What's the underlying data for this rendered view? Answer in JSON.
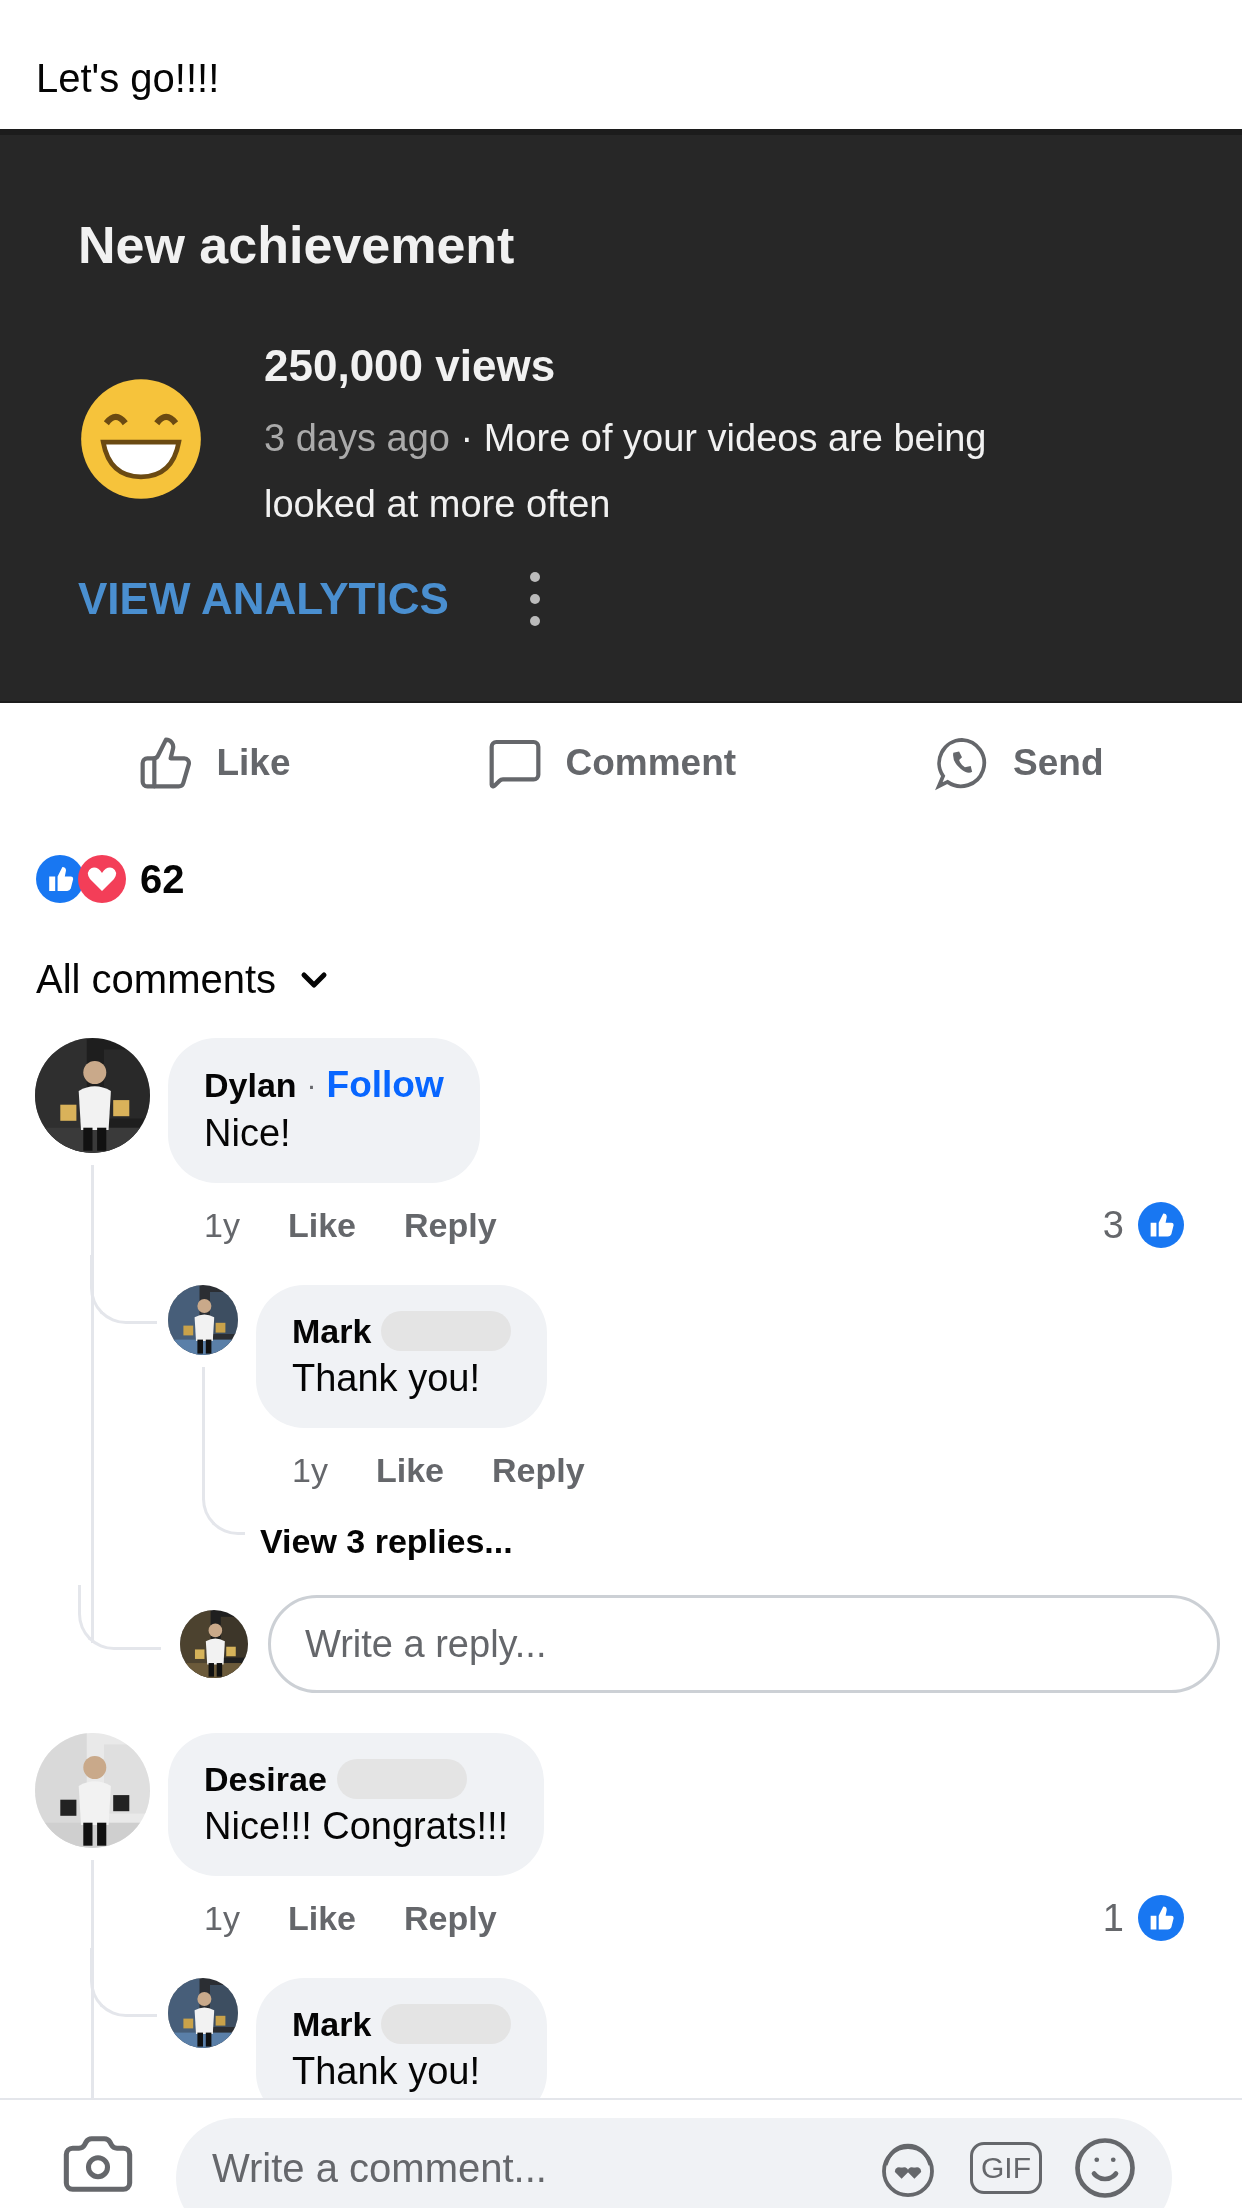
{
  "post": {
    "caption": "Let's go!!!!"
  },
  "shared_screenshot": {
    "title": "New achievement",
    "milestone": "250,000 views",
    "meta": "3 days ago",
    "separator": "·",
    "description": "More of your videos are being looked at more often",
    "action": "VIEW ANALYTICS"
  },
  "actions": [
    {
      "kind": "like",
      "label": "Like"
    },
    {
      "kind": "comment",
      "label": "Comment"
    },
    {
      "kind": "send",
      "label": "Send"
    }
  ],
  "reactions": {
    "icons": [
      {
        "kind": "like"
      },
      {
        "kind": "love"
      }
    ],
    "count": "62"
  },
  "comment_filter": "All comments",
  "comments": [
    {
      "author": "Dylan",
      "separator": "·",
      "follow": "Follow",
      "surname_hidden": false,
      "text": "Nice!",
      "time": "1y",
      "like": "Like",
      "reply": "Reply",
      "like_count": "3",
      "replies": [
        {
          "author": "Mark",
          "surname_hidden": true,
          "text": "Thank you!",
          "time": "1y",
          "like": "Like",
          "reply": "Reply",
          "more_replies": "View 3 replies..."
        }
      ],
      "reply_field": {
        "placeholder": "Write a reply..."
      }
    },
    {
      "author": "Desirae",
      "surname_hidden": true,
      "text": "Nice!!! Congrats!!!",
      "time": "1y",
      "like": "Like",
      "reply": "Reply",
      "like_count": "1",
      "replies": [
        {
          "author": "Mark",
          "surname_hidden": true,
          "text": "Thank you!"
        }
      ]
    }
  ],
  "composer": {
    "placeholder": "Write a comment...",
    "gif_label": "GIF"
  }
}
